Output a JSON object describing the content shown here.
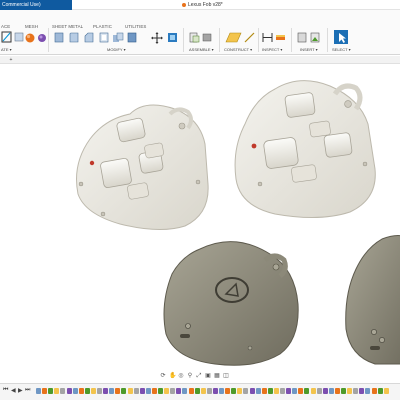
{
  "window": {
    "left_title": "Commercial Use)",
    "doc_title": "Lexus Fob v28*"
  },
  "ribbon": {
    "tabs": [
      {
        "label": "ACE",
        "active": false
      },
      {
        "label": "MESH",
        "active": false
      },
      {
        "label": "SHEET METAL",
        "active": false
      },
      {
        "label": "PLASTIC",
        "active": false
      },
      {
        "label": "UTILITIES",
        "active": false
      }
    ],
    "groups": [
      {
        "label": "ATE ▾"
      },
      {
        "label": "MODIFY ▾"
      },
      {
        "label": "ASSEMBLE ▾"
      },
      {
        "label": "CONSTRUCT ▾"
      },
      {
        "label": "INSPECT ▾"
      },
      {
        "label": "INSERT ▾"
      },
      {
        "label": "SELECT ▾"
      }
    ],
    "accent_color": "#0696d7",
    "select_color": "#1c6fb5"
  },
  "browser_strip": {
    "add_label": "+"
  },
  "scene": {
    "models": [
      {
        "name": "fob-front-left",
        "view": "top",
        "color": "#ebe9e2"
      },
      {
        "name": "fob-front-right",
        "view": "top",
        "color": "#ecebe4"
      },
      {
        "name": "fob-back-left",
        "view": "bottom",
        "color": "#8c8979"
      },
      {
        "name": "fob-back-right",
        "view": "bottom",
        "color": "#8c8979"
      }
    ],
    "indicator_color": "#c0392b"
  },
  "navbar": {
    "icons": [
      "orbit-icon",
      "pan-icon",
      "look-at-icon",
      "zoom-icon",
      "fit-icon",
      "display-icon",
      "grid-icon",
      "viewports-icon"
    ]
  },
  "timeline": {
    "controls": [
      "⏮",
      "◀",
      "▶",
      "⏭"
    ]
  }
}
